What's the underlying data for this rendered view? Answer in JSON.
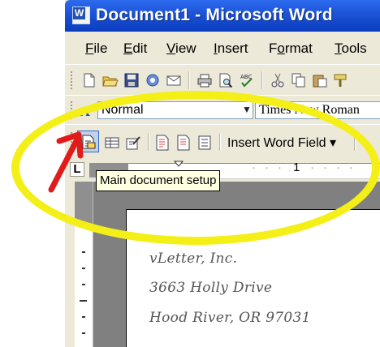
{
  "window": {
    "title": "Document1 - Microsoft Word",
    "app_icon": "word-w-icon"
  },
  "menu": {
    "items": [
      {
        "pre": "",
        "u": "F",
        "post": "ile"
      },
      {
        "pre": "",
        "u": "E",
        "post": "dit"
      },
      {
        "pre": "",
        "u": "V",
        "post": "iew"
      },
      {
        "pre": "",
        "u": "I",
        "post": "nsert"
      },
      {
        "pre": "F",
        "u": "o",
        "post": "rmat"
      },
      {
        "pre": "",
        "u": "T",
        "post": "ools"
      }
    ]
  },
  "standard_toolbar": {
    "icons": [
      "new-document-icon",
      "open-folder-icon",
      "save-icon",
      "permission-icon",
      "email-icon",
      "print-icon",
      "print-preview-icon",
      "spelling-icon",
      "cut-icon",
      "copy-icon",
      "paste-icon",
      "format-painter-icon"
    ]
  },
  "formatting_toolbar": {
    "style_value": "Normal",
    "font_value": "Times New Roman"
  },
  "mail_merge_toolbar": {
    "icons": [
      "main-document-setup-icon",
      "open-data-source-icon",
      "recipients-icon",
      "insert-address-block-icon",
      "insert-greeting-line-icon",
      "insert-merge-fields-icon"
    ],
    "insert_word_field_label": "Insert Word Field"
  },
  "ruler": {
    "tab_selector": "L",
    "number_1": "1"
  },
  "tooltip": {
    "text": "Main document setup"
  },
  "document": {
    "lines": [
      "vLetter, Inc.",
      "3663 Holly Drive",
      "Hood River, OR 97031"
    ]
  },
  "colors": {
    "highlight_ellipse": "#f4ef17",
    "annotation_arrow": "#e11a1a",
    "title_bar": "#0a3cbf"
  }
}
